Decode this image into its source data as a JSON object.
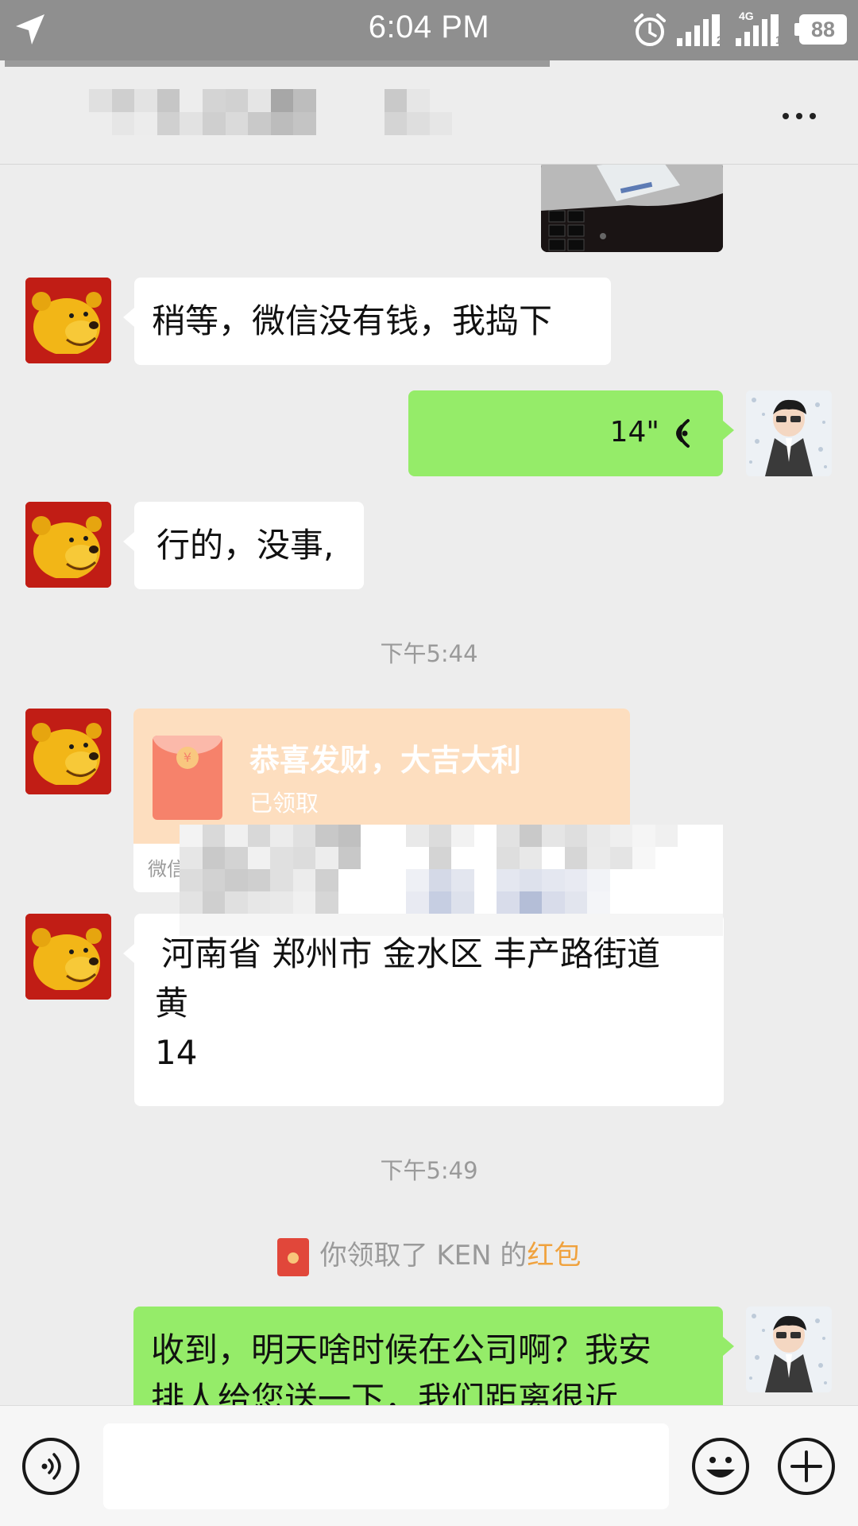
{
  "status_bar": {
    "time": "6:04 PM",
    "sim1_label": "2",
    "sim2_label": "4G",
    "sim2_sub": "1",
    "battery": "88",
    "icons": [
      "location-arrow-icon",
      "alarm-clock-icon",
      "signal-icon",
      "signal-4g-icon",
      "battery-icon"
    ]
  },
  "nav": {
    "more_icon": "ellipsis-icon"
  },
  "messages": {
    "m1": "稍等，微信没有钱，我捣下",
    "m2_duration": "14\"",
    "m3": "行的，没事,",
    "time1": "下午5:44",
    "red_packet": {
      "title": "恭喜发财，大吉大利",
      "status": "已领取",
      "brand": "微信红包",
      "coin": "¥"
    },
    "m5_line1": "河南省 郑州市 金水区 丰产路街道",
    "m5_line2_prefix": "黄",
    "m5_line3_prefix": "14",
    "time2": "下午5:49",
    "notice_prefix": "你领取了 KEN 的",
    "notice_link": "红包",
    "m7_line1": "收到，明天啥时候在公司啊？我安",
    "m7_line2": "排人给您送一下，我们距离很近"
  },
  "input": {
    "placeholder": ""
  },
  "colors": {
    "status_bar_bg": "#8f8f8f",
    "chat_bg": "#ededed",
    "self_bubble": "#95ec69",
    "red_packet_bg": "#fddebf",
    "link": "#f0a23e"
  }
}
